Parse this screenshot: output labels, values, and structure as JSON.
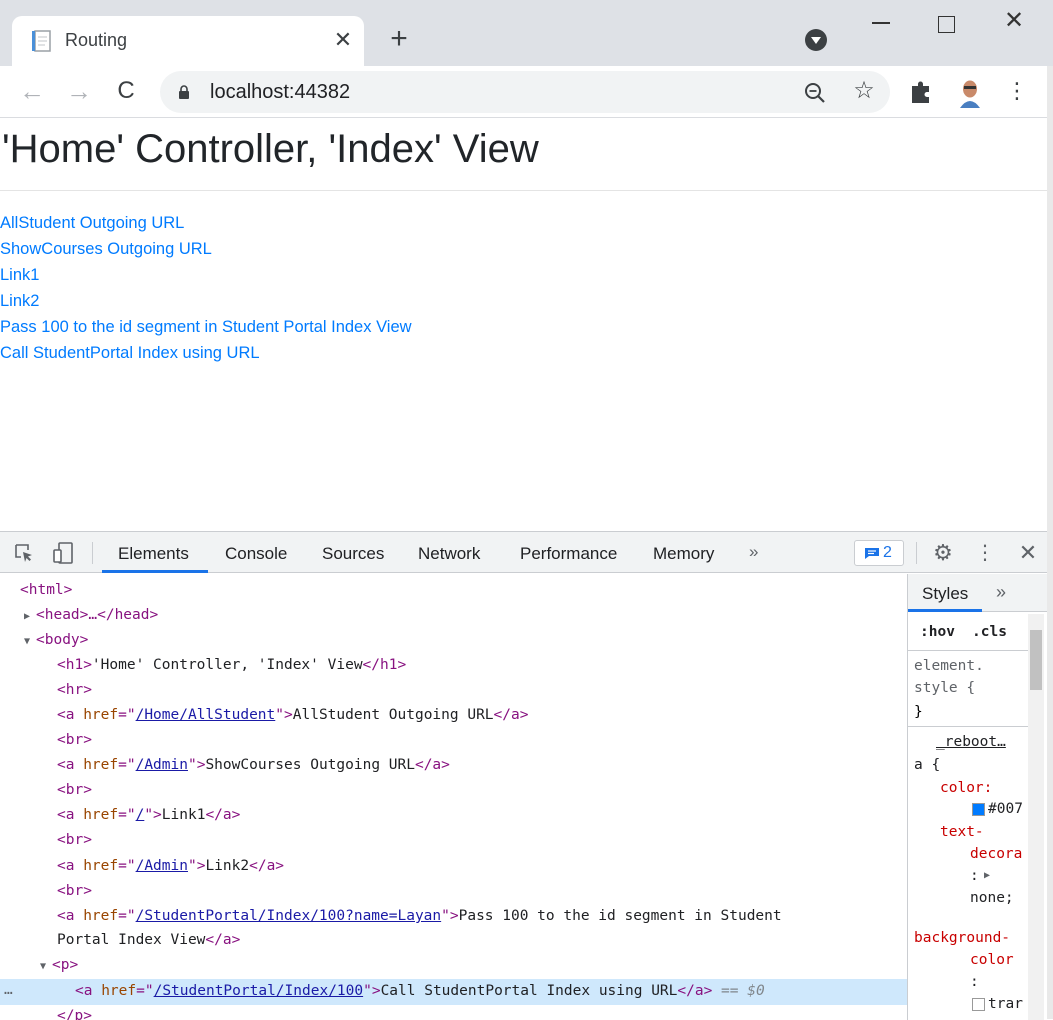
{
  "browser": {
    "tab_title": "Routing",
    "tab_close": "✕",
    "new_tab": "+",
    "url": "localhost:44382",
    "back": "←",
    "forward": "→",
    "reload": "C",
    "star": "☆",
    "menu": "⋮",
    "win_close": "✕"
  },
  "page": {
    "title": "'Home' Controller, 'Index' View",
    "links": [
      "AllStudent Outgoing URL",
      "ShowCourses Outgoing URL",
      "Link1",
      "Link2",
      "Pass 100 to the id segment in Student Portal Index View",
      "Call StudentPortal Index using URL"
    ]
  },
  "devtools": {
    "tabs": [
      "Elements",
      "Console",
      "Sources",
      "Network",
      "Performance",
      "Memory"
    ],
    "more_tabs": "»",
    "issues_count": "2",
    "gear": "⚙",
    "dots": "⋮",
    "close": "✕",
    "dom": {
      "html_open": "<html>",
      "head": "<head>…</head>",
      "body_open": "<body>",
      "h1_open": "<h1>",
      "h1_text": "'Home' Controller, 'Index' View",
      "h1_close": "</h1>",
      "hr": "<hr>",
      "br": "<br>",
      "a_open": "<a ",
      "href": "href",
      "a_close": "</a>",
      "links": [
        {
          "href": "/Home/AllStudent",
          "text": "AllStudent Outgoing URL"
        },
        {
          "href": "/Admin",
          "text": "ShowCourses Outgoing URL"
        },
        {
          "href": "/",
          "text": "Link1"
        },
        {
          "href": "/Admin",
          "text": "Link2"
        },
        {
          "href": "/StudentPortal/Index/100?name=Layan",
          "text": "Pass 100 to the id segment in Student",
          "text_cont": "Portal Index View"
        },
        {
          "href": "/StudentPortal/Index/100",
          "text": "Call StudentPortal Index using URL"
        }
      ],
      "p_open": "<p>",
      "p_close": "</p>",
      "selected_marker": "== $0",
      "ellipsis": "…"
    },
    "styles": {
      "tab": "Styles",
      "more": "»",
      "hov": ":hov",
      "cls": ".cls",
      "element_style_1": "element.",
      "element_style_2": "style {",
      "close_brace": "}",
      "source": "_reboot…",
      "selector": "a {",
      "prop_color": "color:",
      "color_value": "#007",
      "prop_text_1": "text-",
      "prop_text_2": "decora",
      "colon": ":",
      "none_value": "none;",
      "prop_bg_1": "background-",
      "prop_bg_2": "color",
      "tran_value": "trar",
      "swatch_color": "#007bff"
    }
  }
}
